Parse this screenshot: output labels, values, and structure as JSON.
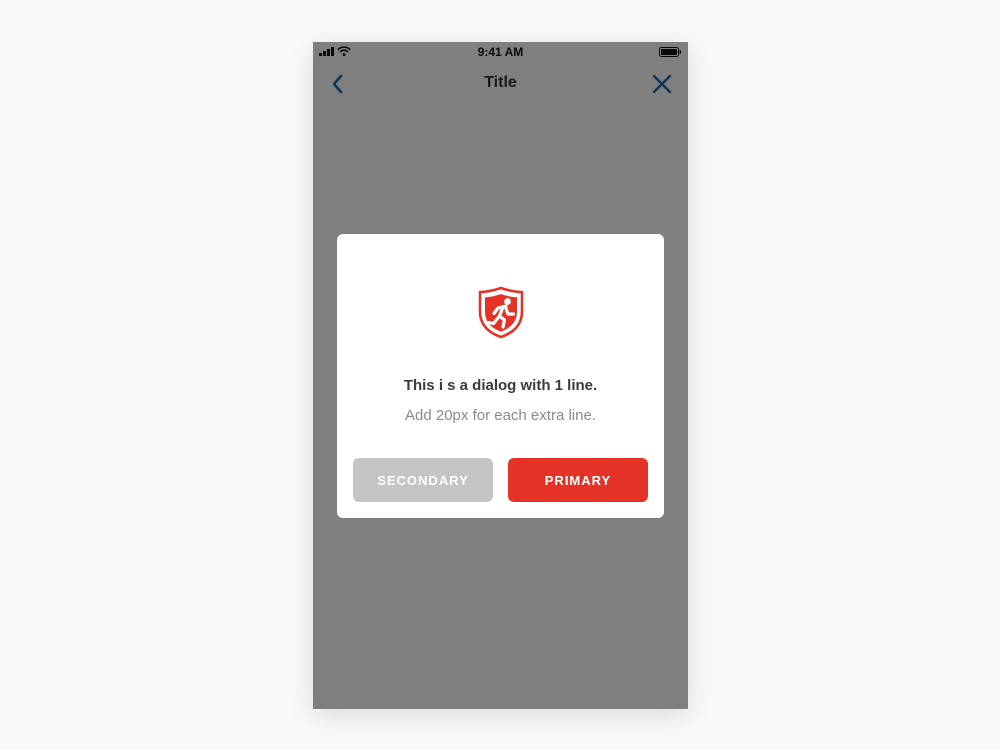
{
  "status_bar": {
    "time": "9:41 AM",
    "signal_icon": "cellular-signal-icon",
    "wifi_icon": "wifi-icon",
    "battery_icon": "battery-icon"
  },
  "nav": {
    "title": "Title",
    "back_icon": "chevron-left-icon",
    "close_icon": "close-icon"
  },
  "dialog": {
    "icon": "emergency-exit-shield-icon",
    "title": "This i s a dialog with 1 line.",
    "subtitle": "Add 20px for each extra line.",
    "secondary_label": "SECONDARY",
    "primary_label": "PRIMARY"
  },
  "colors": {
    "accent": "#1f6fa8",
    "primary": "#e43326",
    "secondary": "#c4c4c4",
    "overlay": "#808080"
  }
}
